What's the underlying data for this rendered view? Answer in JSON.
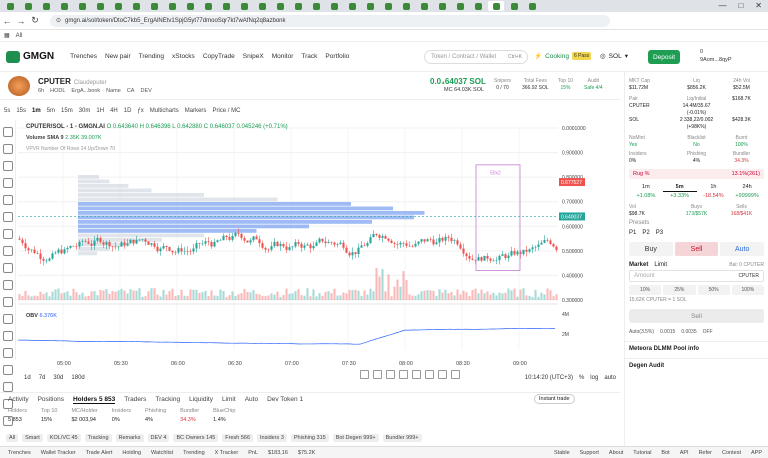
{
  "browser": {
    "url": "gmgn.ai/sol/token/DtoC7kb5_ErgAlNEtv1SpjG5yt77dmooSqr7kt7wAfNq2q8azbonk",
    "bookmark_label": "All",
    "tab_count": 30
  },
  "header": {
    "logo": "GMGN",
    "nav": [
      "Trenches",
      "New pair",
      "Trending",
      "xStocks",
      "CopyTrade",
      "SnipeX",
      "Monitor",
      "Track",
      "Portfolio"
    ],
    "search_placeholder": "Token / Contract / Wallet",
    "search_kbd": "Ctrl+K",
    "cooking": "Cooking",
    "cooking_badge": "6 Pass",
    "chain": "SOL",
    "deposit": "Deposit",
    "wallet_balance": "0",
    "wallet_addr": "9Aom...8qyP"
  },
  "token": {
    "symbol": "CPUTER",
    "name": "Claudeputer",
    "age": "6h",
    "holder_tag": "HODL",
    "creator": "ErgA...bonk",
    "tags": [
      "Name",
      "CA",
      "DEV"
    ],
    "price": "0.0₄64037 SOL",
    "mc_label": "MC",
    "mc": "$4.03K",
    "mc_sol": "64.03K SOL",
    "snipers_label": "Snipers",
    "snipers": "0 / 70",
    "fees_label": "Total Fees",
    "fees": "366.92 SOL",
    "top10_label": "Top 10",
    "top10": "15%",
    "audit_label": "Audit",
    "audit": "Safe 4/4"
  },
  "toolbar": {
    "intervals": [
      "5s",
      "15s",
      "1m",
      "5m",
      "15m",
      "30m",
      "1H",
      "4H",
      "1D"
    ],
    "selected": "1m",
    "items": [
      "Multicharts",
      "Markers",
      "Price / MC"
    ]
  },
  "chart_data": {
    "type": "candlestick",
    "title": "CPUTER/SOL - 1 - GMGN.AI",
    "ohlc_text": "O 0.643640 H 0.646396 L 0.642880 C 0.646037 0.045246 (+0.71%)",
    "volume_text": "Volume SMA 9",
    "volume_values": "2.35K  39.007K",
    "vpvr_text": "VPVR Number Of Rows 24 Up/Down 70",
    "obv_text": "OBV",
    "obv_value": "6.376K",
    "y_labels": [
      "0.0001000",
      "0.900000",
      "0.800000",
      "0.700000",
      "0.600000",
      "0.500000",
      "0.400000",
      "0.300000"
    ],
    "y_range": [
      0.3,
      1.0
    ],
    "x_labels": [
      "05:00",
      "05:30",
      "06:00",
      "06:30",
      "07:00",
      "07:30",
      "08:00",
      "08:30",
      "09:00"
    ],
    "current_price_badge": "0.640037",
    "marker_price_badge": "0.677527",
    "obv_y_labels": [
      "4M",
      "2M"
    ],
    "box_label": "50x2",
    "colors": {
      "up": "#26a69a",
      "down": "#ef5350",
      "vpvr": "#a9c2f5",
      "box": "#c77dd6",
      "obv": "#2962ff"
    }
  },
  "range_bar": {
    "items": [
      "1d",
      "7d",
      "30d",
      "180d"
    ],
    "clock": "10:14:20 (UTC+3)",
    "scale": [
      "%",
      "log",
      "auto"
    ]
  },
  "bottom": {
    "tabs": [
      "Activity",
      "Positions",
      "Holders 5 853",
      "Traders",
      "Tracking",
      "Liquidity",
      "Limit",
      "Auto",
      "Dev Token 1"
    ],
    "active_tab": "Holders 5 853",
    "instant_trade": "Instant trade",
    "stats": [
      {
        "label": "Holders",
        "value": "5 853"
      },
      {
        "label": "Top 10",
        "value": "15%"
      },
      {
        "label": "MC/Holder",
        "value": "$2 003,94"
      },
      {
        "label": "Insiders",
        "value": "0%"
      },
      {
        "label": "Phishing",
        "value": "4%"
      },
      {
        "label": "Bundler",
        "value": "34.3%"
      },
      {
        "label": "BlueChip",
        "value": "1.4%"
      }
    ],
    "filters": [
      "All",
      "Smart",
      "KOL/VC 45",
      "Tracking",
      "Remarks",
      "DEV 4",
      "BC Owners 145",
      "Fresh 566",
      "Insiders 3",
      "Phishing 315",
      "Bot Degen 999+",
      "Bundler 999+"
    ]
  },
  "statusbar": {
    "left": [
      "Trenches",
      "Wallet Tracker",
      "Trade Alert",
      "Holding",
      "Watchlist",
      "Trending",
      "X Tracker",
      "PnL",
      "$183,16",
      "$75.2K"
    ],
    "right": [
      "Stable",
      "Support",
      "About",
      "Tutorial",
      "Bot",
      "API",
      "Refer",
      "Contest",
      "APP"
    ]
  },
  "right_panel": {
    "top": [
      {
        "label": "MKT Cap",
        "value": "$11.72M"
      },
      {
        "label": "Liq",
        "value": "$856.2K"
      },
      {
        "label": "24h Vol",
        "value": "$52.5M"
      }
    ],
    "pair_row": [
      {
        "label": "Pair",
        "value": "CPUTER"
      },
      {
        "label": "Liq/Initial",
        "value": "14.4M/35.67 (-0.01%)"
      },
      {
        "label": "",
        "value": "$168.7K"
      }
    ],
    "sol_row": [
      {
        "label": "",
        "value": "SOL"
      },
      {
        "label": "",
        "value": "2 338,22/0.002 (+98K%)"
      },
      {
        "label": "",
        "value": "$428.3K"
      }
    ],
    "flags": [
      {
        "label": "NoMint",
        "value": "Yes"
      },
      {
        "label": "Blacklist",
        "value": "No"
      },
      {
        "label": "Burnt",
        "value": "100%"
      }
    ],
    "flags2": [
      {
        "label": "Insiders",
        "value": "0%"
      },
      {
        "label": "Phishing",
        "value": "4%"
      },
      {
        "label": "Bundler",
        "value": "34.3%"
      }
    ],
    "rug": "Rug %",
    "rug_value": "13.1%(261)",
    "timeframes": [
      {
        "tf": "1m",
        "chg": "+1.08%"
      },
      {
        "tf": "5m",
        "chg": "+3.33%"
      },
      {
        "tf": "1h",
        "chg": "-18.54%"
      },
      {
        "tf": "24h",
        "chg": "+99999%"
      }
    ],
    "vol_row": [
      {
        "label": "Vol",
        "value": "$98.7K"
      },
      {
        "label": "Buys",
        "value": "173/$57K"
      },
      {
        "label": "Sells",
        "value": "168/$41K"
      }
    ],
    "presets": "Presets",
    "preset_items": [
      "P1",
      "P2",
      "P3"
    ],
    "buy": "Buy",
    "sell": "Sell",
    "auto": "Auto",
    "order_types": [
      "Market",
      "Limit"
    ],
    "balance": "Bal: 0 CPUTER",
    "amount_placeholder": "Amount",
    "amount_unit": "CPUTER",
    "pcts": [
      "10%",
      "25%",
      "50%",
      "100%"
    ],
    "rate": "15,62K CPUTER = 1 SOL",
    "sell_button": "Sell",
    "settings": [
      "Auto(3.5%)",
      "0.0015",
      "0.0035",
      "OFF"
    ],
    "pool_info": "Meteora DLMM Pool info",
    "degen_audit": "Degen Audit"
  }
}
